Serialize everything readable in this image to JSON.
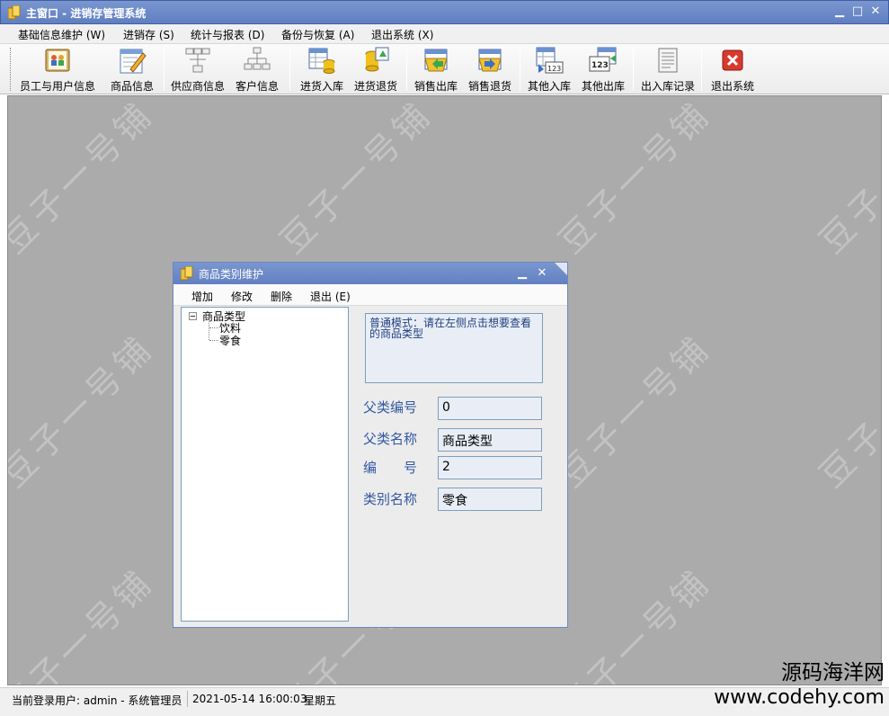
{
  "window": {
    "title": "主窗口 - 进销存管理系统"
  },
  "menu": [
    "基础信息维护 (W)",
    "进销存 (S)",
    "统计与报表 (D)",
    "备份与恢复 (A)",
    "退出系统 (X)"
  ],
  "toolbar": [
    {
      "label": "员工与用户信息",
      "icon": "users-book-icon"
    },
    {
      "label": "商品信息",
      "icon": "edit-sheet-icon"
    },
    {
      "label": "供应商信息",
      "icon": "supplier-tree-icon"
    },
    {
      "label": "客户信息",
      "icon": "customer-tree-icon"
    },
    {
      "label": "进货入库",
      "icon": "stock-in-icon"
    },
    {
      "label": "进货退货",
      "icon": "stock-return-icon"
    },
    {
      "label": "销售出库",
      "icon": "sales-out-icon"
    },
    {
      "label": "销售退货",
      "icon": "sales-return-icon"
    },
    {
      "label": "其他入库",
      "icon": "other-in-icon"
    },
    {
      "label": "其他出库",
      "icon": "other-out-icon"
    },
    {
      "label": "出入库记录",
      "icon": "records-icon"
    },
    {
      "label": "退出系统",
      "icon": "exit-icon"
    }
  ],
  "watermark": "豆子一号铺",
  "child_window": {
    "title": "商品类别维护",
    "menu": [
      "增加",
      "修改",
      "删除",
      "退出 (E)"
    ],
    "tree": {
      "root": "商品类型",
      "children": [
        "饮料",
        "零食"
      ]
    },
    "hint": "普通模式：请在左侧点击想要查看的商品类型",
    "fields": [
      {
        "label": "父类编号",
        "value": "0"
      },
      {
        "label": "父类名称",
        "value": "商品类型"
      },
      {
        "label": "编　　号",
        "value": "2"
      },
      {
        "label": "类别名称",
        "value": "零食"
      }
    ]
  },
  "status": {
    "user": "当前登录用户: admin - 系统管理员",
    "datetime": "2021-05-14 16:00:03",
    "weekday": "星期五"
  },
  "brand": {
    "name": "源码海洋网",
    "url": "www.codehy.com"
  },
  "colors": {
    "titlebar": "#6a88c8",
    "workspace": "#ababab",
    "label_blue": "#3358a2",
    "exit_red": "#d83a2e"
  }
}
